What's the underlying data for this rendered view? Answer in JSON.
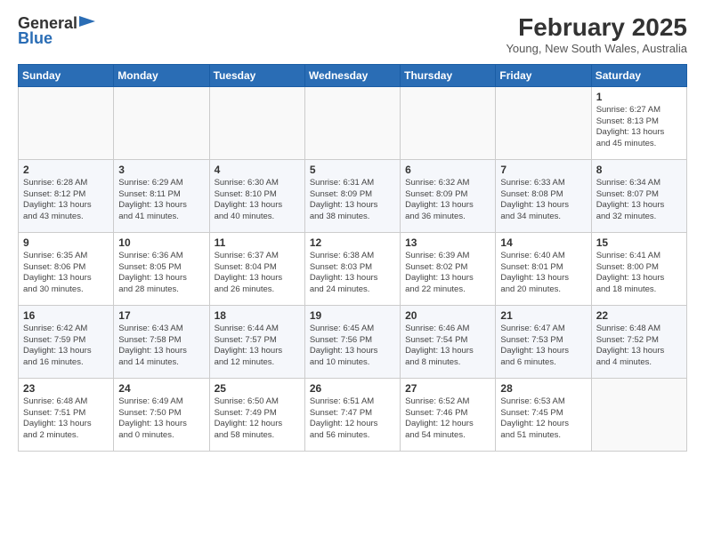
{
  "header": {
    "logo_general": "General",
    "logo_blue": "Blue",
    "title": "February 2025",
    "subtitle": "Young, New South Wales, Australia"
  },
  "days_of_week": [
    "Sunday",
    "Monday",
    "Tuesday",
    "Wednesday",
    "Thursday",
    "Friday",
    "Saturday"
  ],
  "weeks": [
    [
      {
        "day": "",
        "text": ""
      },
      {
        "day": "",
        "text": ""
      },
      {
        "day": "",
        "text": ""
      },
      {
        "day": "",
        "text": ""
      },
      {
        "day": "",
        "text": ""
      },
      {
        "day": "",
        "text": ""
      },
      {
        "day": "1",
        "text": "Sunrise: 6:27 AM\nSunset: 8:13 PM\nDaylight: 13 hours\nand 45 minutes."
      }
    ],
    [
      {
        "day": "2",
        "text": "Sunrise: 6:28 AM\nSunset: 8:12 PM\nDaylight: 13 hours\nand 43 minutes."
      },
      {
        "day": "3",
        "text": "Sunrise: 6:29 AM\nSunset: 8:11 PM\nDaylight: 13 hours\nand 41 minutes."
      },
      {
        "day": "4",
        "text": "Sunrise: 6:30 AM\nSunset: 8:10 PM\nDaylight: 13 hours\nand 40 minutes."
      },
      {
        "day": "5",
        "text": "Sunrise: 6:31 AM\nSunset: 8:09 PM\nDaylight: 13 hours\nand 38 minutes."
      },
      {
        "day": "6",
        "text": "Sunrise: 6:32 AM\nSunset: 8:09 PM\nDaylight: 13 hours\nand 36 minutes."
      },
      {
        "day": "7",
        "text": "Sunrise: 6:33 AM\nSunset: 8:08 PM\nDaylight: 13 hours\nand 34 minutes."
      },
      {
        "day": "8",
        "text": "Sunrise: 6:34 AM\nSunset: 8:07 PM\nDaylight: 13 hours\nand 32 minutes."
      }
    ],
    [
      {
        "day": "9",
        "text": "Sunrise: 6:35 AM\nSunset: 8:06 PM\nDaylight: 13 hours\nand 30 minutes."
      },
      {
        "day": "10",
        "text": "Sunrise: 6:36 AM\nSunset: 8:05 PM\nDaylight: 13 hours\nand 28 minutes."
      },
      {
        "day": "11",
        "text": "Sunrise: 6:37 AM\nSunset: 8:04 PM\nDaylight: 13 hours\nand 26 minutes."
      },
      {
        "day": "12",
        "text": "Sunrise: 6:38 AM\nSunset: 8:03 PM\nDaylight: 13 hours\nand 24 minutes."
      },
      {
        "day": "13",
        "text": "Sunrise: 6:39 AM\nSunset: 8:02 PM\nDaylight: 13 hours\nand 22 minutes."
      },
      {
        "day": "14",
        "text": "Sunrise: 6:40 AM\nSunset: 8:01 PM\nDaylight: 13 hours\nand 20 minutes."
      },
      {
        "day": "15",
        "text": "Sunrise: 6:41 AM\nSunset: 8:00 PM\nDaylight: 13 hours\nand 18 minutes."
      }
    ],
    [
      {
        "day": "16",
        "text": "Sunrise: 6:42 AM\nSunset: 7:59 PM\nDaylight: 13 hours\nand 16 minutes."
      },
      {
        "day": "17",
        "text": "Sunrise: 6:43 AM\nSunset: 7:58 PM\nDaylight: 13 hours\nand 14 minutes."
      },
      {
        "day": "18",
        "text": "Sunrise: 6:44 AM\nSunset: 7:57 PM\nDaylight: 13 hours\nand 12 minutes."
      },
      {
        "day": "19",
        "text": "Sunrise: 6:45 AM\nSunset: 7:56 PM\nDaylight: 13 hours\nand 10 minutes."
      },
      {
        "day": "20",
        "text": "Sunrise: 6:46 AM\nSunset: 7:54 PM\nDaylight: 13 hours\nand 8 minutes."
      },
      {
        "day": "21",
        "text": "Sunrise: 6:47 AM\nSunset: 7:53 PM\nDaylight: 13 hours\nand 6 minutes."
      },
      {
        "day": "22",
        "text": "Sunrise: 6:48 AM\nSunset: 7:52 PM\nDaylight: 13 hours\nand 4 minutes."
      }
    ],
    [
      {
        "day": "23",
        "text": "Sunrise: 6:48 AM\nSunset: 7:51 PM\nDaylight: 13 hours\nand 2 minutes."
      },
      {
        "day": "24",
        "text": "Sunrise: 6:49 AM\nSunset: 7:50 PM\nDaylight: 13 hours\nand 0 minutes."
      },
      {
        "day": "25",
        "text": "Sunrise: 6:50 AM\nSunset: 7:49 PM\nDaylight: 12 hours\nand 58 minutes."
      },
      {
        "day": "26",
        "text": "Sunrise: 6:51 AM\nSunset: 7:47 PM\nDaylight: 12 hours\nand 56 minutes."
      },
      {
        "day": "27",
        "text": "Sunrise: 6:52 AM\nSunset: 7:46 PM\nDaylight: 12 hours\nand 54 minutes."
      },
      {
        "day": "28",
        "text": "Sunrise: 6:53 AM\nSunset: 7:45 PM\nDaylight: 12 hours\nand 51 minutes."
      },
      {
        "day": "",
        "text": ""
      }
    ]
  ]
}
